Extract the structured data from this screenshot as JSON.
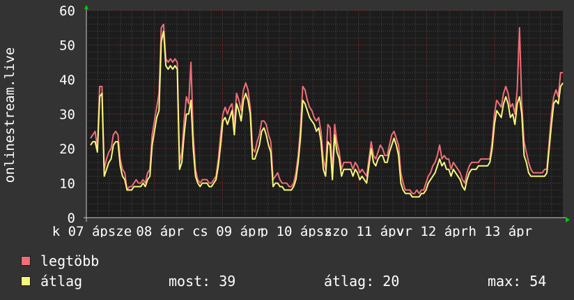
{
  "colors": {
    "background": "#333333",
    "plot_background": "#1c1c1c",
    "grid_minor": "#4a4a4a",
    "grid_major": "#8a3a3a",
    "axis": "#c8c8c8",
    "arrow": "#00cc00",
    "max_series": "#f06e78",
    "avg_series": "#f7f77a"
  },
  "chart_data": {
    "type": "line",
    "ylabel": "onlinestream.live",
    "ylim": [
      0,
      60
    ],
    "yticks": [
      0,
      10,
      20,
      30,
      40,
      50,
      60
    ],
    "grid": true,
    "xtick_labels": [
      "k 07 ápsze",
      "08 ápr",
      "cs 09 ápr",
      "p 10 ápsz",
      "szo 11 ápv",
      "vr 12 ápr",
      "h 13 ápr"
    ],
    "series": [
      {
        "name": "legtöbb",
        "color": "#f06e78",
        "values": [
          23,
          24,
          25,
          20,
          38,
          38,
          14,
          17,
          19,
          20,
          24,
          25,
          24,
          17,
          14,
          13,
          8,
          9,
          9,
          10,
          11,
          10,
          10,
          11,
          10,
          13,
          14,
          24,
          28,
          32,
          36,
          55,
          56,
          46,
          45,
          46,
          45,
          46,
          45,
          16,
          19,
          28,
          35,
          33,
          45,
          24,
          14,
          11,
          10,
          11,
          11,
          11,
          10,
          10,
          11,
          12,
          17,
          24,
          30,
          32,
          30,
          32,
          33,
          27,
          36,
          34,
          31,
          37,
          39,
          37,
          32,
          20,
          19,
          22,
          24,
          28,
          28,
          27,
          24,
          22,
          11,
          12,
          13,
          11,
          10,
          10,
          10,
          9,
          9,
          10,
          13,
          18,
          26,
          38,
          37,
          34,
          32,
          31,
          29,
          28,
          29,
          25,
          17,
          14,
          27,
          26,
          13,
          27,
          22,
          19,
          14,
          16,
          16,
          16,
          16,
          14,
          16,
          15,
          13,
          14,
          13,
          12,
          17,
          22,
          18,
          17,
          19,
          21,
          20,
          18,
          18,
          21,
          24,
          25,
          23,
          21,
          13,
          10,
          8,
          8,
          8,
          7,
          7,
          8,
          7,
          8,
          8,
          10,
          12,
          13,
          15,
          16,
          18,
          21,
          17,
          18,
          17,
          17,
          14,
          16,
          15,
          14,
          13,
          11,
          10,
          13,
          15,
          16,
          16,
          16,
          16,
          17,
          17,
          17,
          17,
          17,
          22,
          30,
          34,
          33,
          32,
          36,
          38,
          36,
          32,
          33,
          30,
          37,
          55,
          33,
          22,
          19,
          16,
          14,
          13,
          13,
          13,
          13,
          13,
          14,
          14,
          22,
          30,
          35,
          37,
          35,
          42,
          42
        ]
      },
      {
        "name": "átlag",
        "color": "#f7f77a",
        "values": [
          21,
          22,
          22,
          19,
          35,
          36,
          12,
          14,
          16,
          17,
          21,
          22,
          22,
          15,
          12,
          11,
          8,
          8,
          8,
          9,
          9,
          9,
          9,
          10,
          9,
          11,
          12,
          21,
          25,
          29,
          31,
          51,
          54,
          44,
          43,
          44,
          43,
          44,
          43,
          14,
          16,
          24,
          30,
          30,
          34,
          20,
          12,
          10,
          9,
          10,
          10,
          10,
          9,
          9,
          10,
          11,
          15,
          21,
          28,
          29,
          27,
          29,
          31,
          24,
          33,
          31,
          28,
          34,
          36,
          34,
          30,
          17,
          17,
          19,
          21,
          25,
          26,
          24,
          21,
          19,
          9,
          10,
          10,
          9,
          9,
          8,
          8,
          8,
          8,
          9,
          11,
          16,
          23,
          34,
          33,
          31,
          29,
          28,
          27,
          25,
          26,
          22,
          14,
          12,
          22,
          21,
          11,
          24,
          19,
          17,
          12,
          14,
          14,
          14,
          14,
          12,
          14,
          13,
          11,
          12,
          11,
          10,
          15,
          20,
          16,
          15,
          17,
          18,
          18,
          16,
          16,
          19,
          21,
          23,
          21,
          18,
          10,
          8,
          7,
          7,
          7,
          6,
          6,
          6,
          6,
          7,
          7,
          8,
          10,
          11,
          12,
          13,
          15,
          17,
          15,
          16,
          14,
          14,
          12,
          14,
          13,
          12,
          11,
          9,
          8,
          11,
          13,
          14,
          14,
          14,
          15,
          15,
          15,
          15,
          15,
          16,
          20,
          27,
          31,
          30,
          29,
          33,
          35,
          33,
          29,
          30,
          27,
          33,
          35,
          30,
          18,
          16,
          13,
          12,
          12,
          12,
          12,
          12,
          12,
          12,
          13,
          20,
          27,
          33,
          34,
          33,
          38,
          39
        ]
      }
    ]
  },
  "legend": {
    "items": [
      {
        "label": "legtöbb",
        "color": "#f06e78"
      },
      {
        "label": "átlag",
        "color": "#f7f77a"
      }
    ]
  },
  "stats": {
    "most": "most: 39",
    "atlag": "átlag: 20",
    "max": "max: 54"
  }
}
